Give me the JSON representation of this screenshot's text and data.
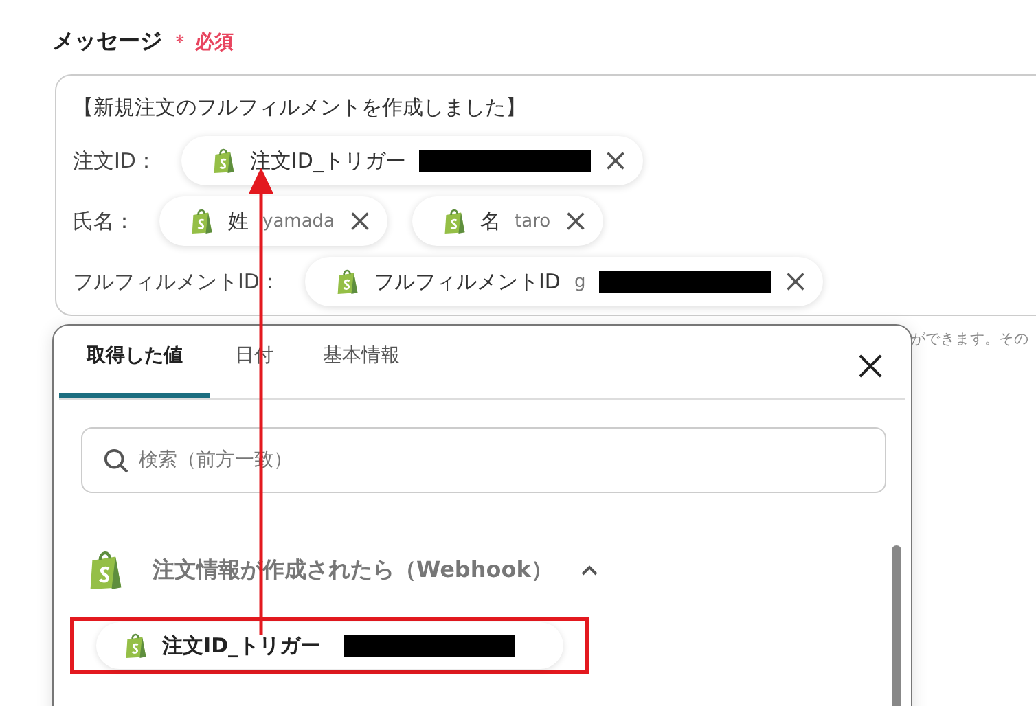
{
  "field": {
    "label": "メッセージ",
    "required_mark": "＊",
    "required_label": "必須"
  },
  "message": {
    "title": "【新規注文のフルフィルメントを作成しました】",
    "lines": [
      {
        "label": "注文ID：",
        "chips": [
          {
            "label": "注文ID_トリガー",
            "redacted": true
          }
        ]
      },
      {
        "label": "氏名：",
        "chips": [
          {
            "label": "姓",
            "value": "yamada",
            "redacted": false
          },
          {
            "label": "名",
            "value": "taro",
            "redacted": false
          }
        ]
      },
      {
        "label": "フルフィルメントID：",
        "chips": [
          {
            "label": "フルフィルメントID",
            "value": "g",
            "redacted": true
          }
        ]
      }
    ]
  },
  "helper_text": "ができます。その",
  "popup": {
    "tabs": [
      {
        "label": "取得した値",
        "selected": true
      },
      {
        "label": "日付",
        "selected": false
      },
      {
        "label": "基本情報",
        "selected": false
      }
    ],
    "search": {
      "placeholder": "検索（前方一致）"
    },
    "group": {
      "title": "注文情報が作成されたら（Webhook）",
      "expanded": true,
      "items": [
        {
          "label": "注文ID_トリガー",
          "redacted": true,
          "highlighted": true
        }
      ]
    }
  }
}
